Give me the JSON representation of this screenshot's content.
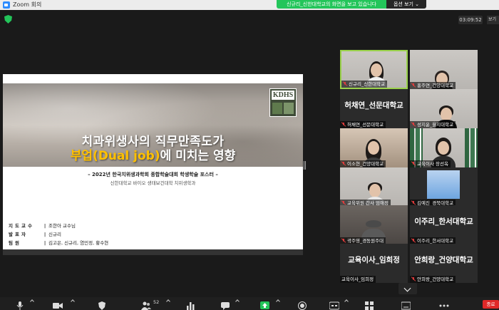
{
  "window": {
    "title": "Zoom 회의"
  },
  "share_banner": {
    "text": "신규리_신한대학교의 화면을 보고 있습니다",
    "view_options": "옵션 보기 ⌄"
  },
  "meeting": {
    "timer": "03:09:52",
    "view_tab": "보기"
  },
  "slide": {
    "logo_text": "KDHS",
    "title_line1": "치과위생사의 직무만족도가",
    "title_line2_highlight": "부업(Dual job)",
    "title_line2_rest": "에 미치는 영향",
    "subtitle1": "– 2022년 한국치위생과학회 종합학술대회 학생학술 포스터 –",
    "subtitle2": "신한대학교 바이오 생태보건대학 치위생학과",
    "info": [
      {
        "key": "지도교수",
        "value": "조한아 교수님"
      },
      {
        "key": "발표자",
        "value": "신규리"
      },
      {
        "key": "팀원",
        "value": "김고은, 신규리, 염민정, 황수현"
      }
    ]
  },
  "participants": [
    {
      "name": "신규리_신한대학교",
      "kind": "video",
      "active": true
    },
    {
      "name": "홍주연_건양대학교",
      "kind": "video"
    },
    {
      "name": "허채연_선문대학교",
      "kind": "name",
      "big": "허채연_선문대학교"
    },
    {
      "name": "성지윤_을지대학교",
      "kind": "video"
    },
    {
      "name": "이소현_건양대학교",
      "kind": "video"
    },
    {
      "name": "교육이사 장선옥",
      "kind": "video"
    },
    {
      "name": "교육위원 간사 엄애정",
      "kind": "video"
    },
    {
      "name": "김예진_경북대학교",
      "kind": "video"
    },
    {
      "name": "곽주영_경동원주대",
      "kind": "video"
    },
    {
      "name": "이주리_한서대학교",
      "kind": "name",
      "big": "이주리_한서대학교"
    },
    {
      "name": "교육이사_임희정",
      "kind": "name",
      "big": "교육이사_임희정"
    },
    {
      "name": "안희랑_건양대학교",
      "kind": "name",
      "big": "안희랑_건양대학교"
    }
  ],
  "toolbar": {
    "participants_count": "52",
    "end_label": "종료"
  }
}
